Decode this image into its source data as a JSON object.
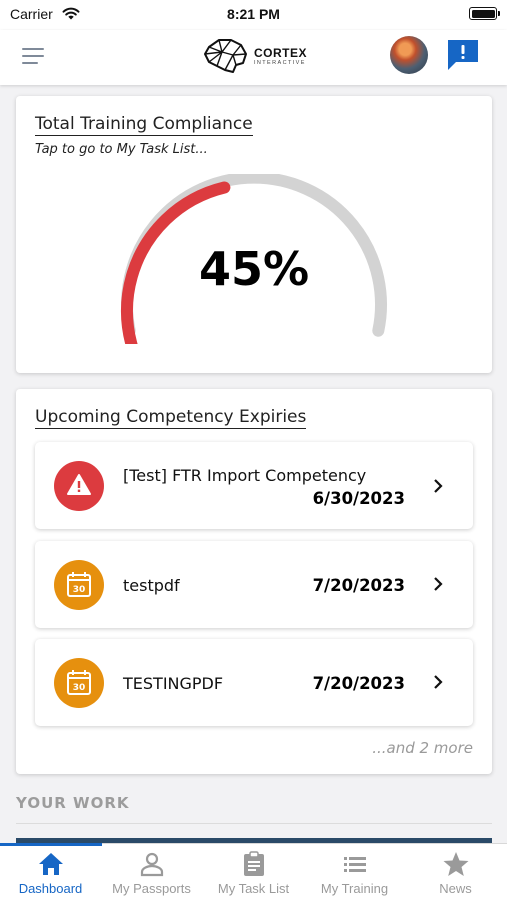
{
  "status_bar": {
    "carrier": "Carrier",
    "time": "8:21 PM"
  },
  "header": {
    "logo": {
      "title": "CORTEX",
      "subtitle": "INTERACTIVE"
    },
    "icons": {
      "menu": "hamburger-menu-icon",
      "avatar": "user-avatar",
      "alert": "alert-message-icon"
    },
    "accent_color": "#1666c5"
  },
  "compliance_card": {
    "title": "Total Training Compliance",
    "subtitle": "Tap to go to My Task List...",
    "percent_label": "45%",
    "progress_fraction": 0.45,
    "colors": {
      "progress": "#dc3b3f",
      "track": "#d3d3d3"
    }
  },
  "expiries_card": {
    "title": "Upcoming Competency Expiries",
    "items": [
      {
        "name": "[Test] FTR Import Competency",
        "date": "6/30/2023",
        "icon": "warning-icon",
        "icon_color": "#dc3b3f"
      },
      {
        "name": "testpdf",
        "date": "7/20/2023",
        "icon": "calendar-30-icon",
        "icon_badge": "30",
        "icon_color": "#e6900e"
      },
      {
        "name": "TESTINGPDF",
        "date": "7/20/2023",
        "icon": "calendar-30-icon",
        "icon_badge": "30",
        "icon_color": "#e6900e"
      }
    ],
    "more_text": "...and 2 more"
  },
  "your_work": {
    "label": "YOUR WORK"
  },
  "tab_bar": {
    "active_index": 0,
    "tabs": [
      {
        "label": "Dashboard",
        "icon": "home-icon"
      },
      {
        "label": "My Passports",
        "icon": "person-icon"
      },
      {
        "label": "My Task List",
        "icon": "clipboard-icon"
      },
      {
        "label": "My Training",
        "icon": "list-icon"
      },
      {
        "label": "News",
        "icon": "star-icon"
      }
    ]
  }
}
